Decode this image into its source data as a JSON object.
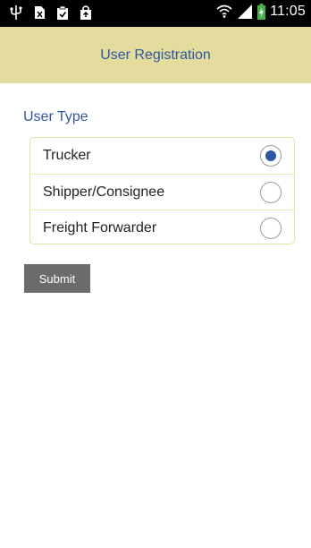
{
  "status_bar": {
    "time": "11:05",
    "left_icons": [
      "usb-icon",
      "sim-icon",
      "clipboard-icon",
      "bag-icon"
    ],
    "right_icons": [
      "wifi-icon",
      "signal-icon",
      "battery-charging-icon"
    ]
  },
  "header": {
    "title": "User Registration"
  },
  "form": {
    "section_label": "User Type",
    "options": [
      {
        "label": "Trucker",
        "selected": true
      },
      {
        "label": "Shipper/Consignee",
        "selected": false
      },
      {
        "label": "Freight Forwarder",
        "selected": false
      }
    ],
    "submit_label": "Submit"
  },
  "colors": {
    "header_bg": "#e3dc9c",
    "accent": "#2f55a3",
    "button_bg": "#6b6b6b"
  }
}
